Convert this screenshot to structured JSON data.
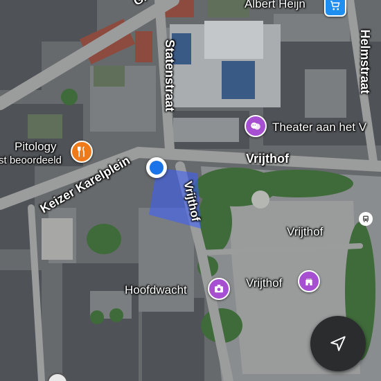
{
  "map": {
    "streets": {
      "top_left": "Gr",
      "statenstraat": "Statenstraat",
      "helmstraat": "Helmstraat",
      "keizer_karelplein": "Keizer Karelplein",
      "vrijthof_road": "Vrijthof",
      "vrijthof_vertical": "Vrijthof"
    },
    "places": {
      "albert_heijn": "Albert Heijn",
      "theater": "Theater aan het V",
      "pitology": "Pitology",
      "pitology_sub": "st beoordeeld",
      "vrijthof_area": "Vrijthof",
      "vrijthof_poi": "Vrijthof",
      "hoofdwacht": "Hoofdwacht"
    },
    "icons": {
      "albert_heijn": "shopping-cart-icon",
      "theater": "theater-masks-icon",
      "pitology": "restaurant-icon",
      "vrijthof_poi": "castle-icon",
      "hoofdwacht": "museum-icon",
      "bus": "bus-stop-icon",
      "navigation": "navigation-arrow-icon",
      "location": "my-location-dot"
    },
    "colors": {
      "poi_purple": "#a64fd1",
      "poi_orange": "#ef7a1a",
      "poi_blue": "#1f8ef1",
      "user_location": "#1a73e8",
      "nav_button": "#2b2c2e"
    }
  }
}
